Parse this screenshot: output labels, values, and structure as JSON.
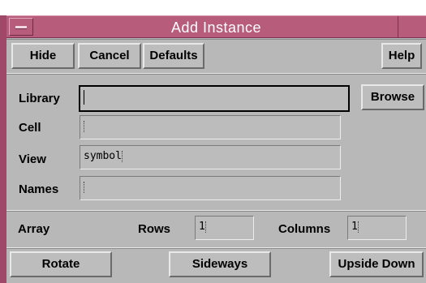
{
  "window": {
    "title": "Add Instance"
  },
  "toolbar": {
    "hide_label": "Hide",
    "cancel_label": "Cancel",
    "defaults_label": "Defaults",
    "help_label": "Help"
  },
  "form": {
    "library_label": "Library",
    "library_value": "",
    "cell_label": "Cell",
    "cell_value": "",
    "view_label": "View",
    "view_value": "symbol",
    "names_label": "Names",
    "names_value": "",
    "browse_label": "Browse"
  },
  "array": {
    "label": "Array",
    "rows_label": "Rows",
    "rows_value": "1",
    "columns_label": "Columns",
    "columns_value": "1"
  },
  "transform": {
    "rotate_label": "Rotate",
    "sideways_label": "Sideways",
    "upside_down_label": "Upside Down"
  }
}
